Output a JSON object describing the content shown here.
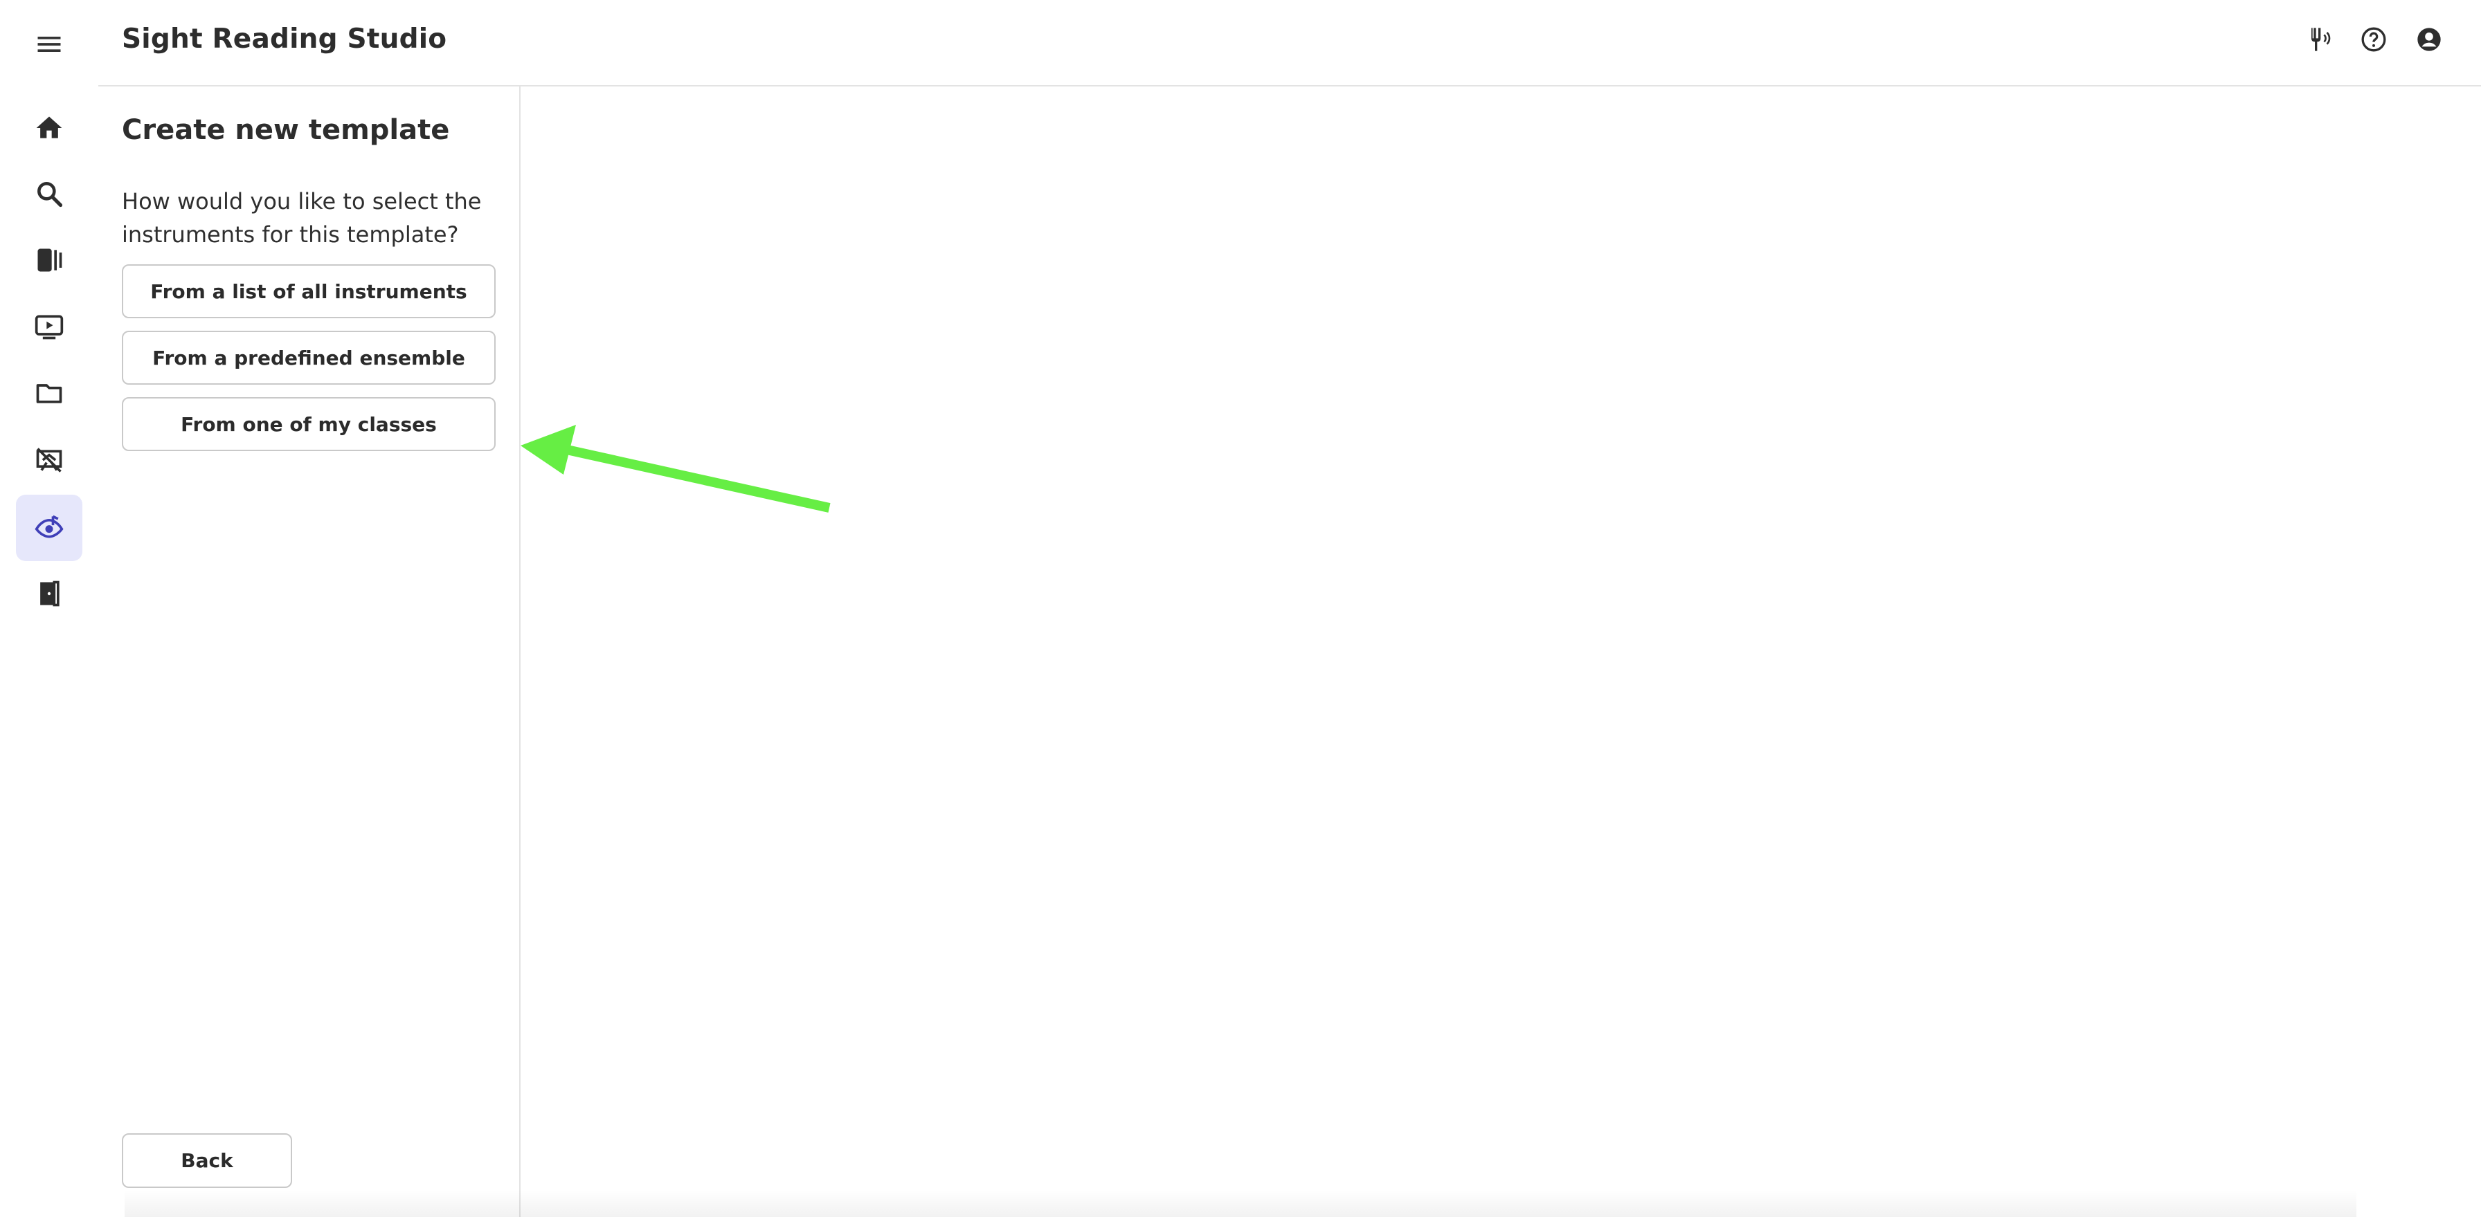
{
  "app": {
    "title": "Sight Reading Studio"
  },
  "rail": {
    "items": [
      {
        "icon": "menu-icon",
        "active": false
      },
      {
        "icon": "home-icon",
        "active": false
      },
      {
        "icon": "search-icon",
        "active": false
      },
      {
        "icon": "library-icon",
        "active": false
      },
      {
        "icon": "video-icon",
        "active": false
      },
      {
        "icon": "folder-icon",
        "active": false
      },
      {
        "icon": "teaching-icon",
        "active": false
      },
      {
        "icon": "sight-reading-icon",
        "active": true
      },
      {
        "icon": "exit-door-icon",
        "active": false
      }
    ],
    "accent_color": "#3f3fb8",
    "active_bg": "#e6e7fb"
  },
  "header": {
    "icons": [
      "tuning-fork-icon",
      "help-icon",
      "account-icon"
    ]
  },
  "panel": {
    "title": "Create new template",
    "question": "How would you like to select the instruments for this template?",
    "options": [
      {
        "label": "From a list of all instruments"
      },
      {
        "label": "From a predefined ensemble"
      },
      {
        "label": "From one of my classes"
      }
    ],
    "back_label": "Back"
  },
  "annotation": {
    "arrow_color": "#66ee44"
  }
}
